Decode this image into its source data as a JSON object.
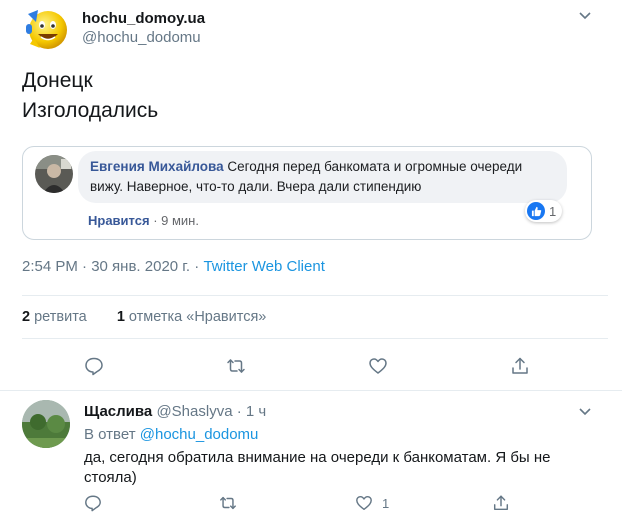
{
  "main_tweet": {
    "display_name": "hochu_domoy.ua",
    "handle": "@hochu_dodomu",
    "text_line1": "Донецк",
    "text_line2": "Изголодались",
    "quote": {
      "author": "Евгения Михайлова",
      "text": "Сегодня перед банкомата и огромные очереди вижу. Наверное, что-то дали. Вчера дали стипендию",
      "like_label": "Нравится",
      "time": "· 9 мин.",
      "reaction_count": "1"
    },
    "timestamp": "2:54 PM · 30 янв. 2020 г. · ",
    "client": "Twitter Web Client",
    "retweets_count": "2",
    "retweets_label": "ретвита",
    "likes_count": "1",
    "likes_label": "отметка «Нравится»"
  },
  "reply": {
    "name": "Щаслива",
    "handle": "@Shaslyva",
    "time": "· 1 ч",
    "reply_to_prefix": "В ответ ",
    "reply_to_mention": "@hochu_dodomu",
    "text": "да, сегодня обратилa внимание на очереди к банкоматам. Я бы не стояла)",
    "like_count": "1"
  },
  "icons": {
    "reply": "speech-bubble-icon",
    "retweet": "retweet-arrows-icon",
    "like": "heart-icon",
    "share": "share-upload-icon",
    "caret": "chevron-down-icon"
  },
  "colors": {
    "link": "#1b95e0",
    "muted": "#657786",
    "fb_blue": "#385898"
  }
}
